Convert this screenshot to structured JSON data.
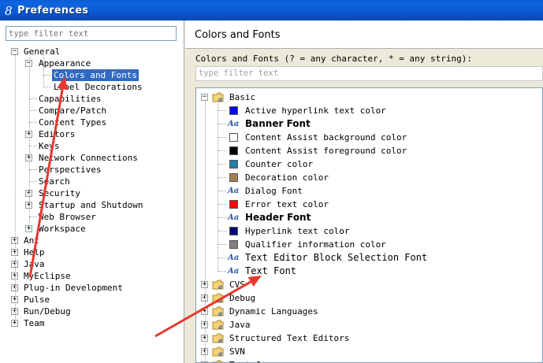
{
  "window": {
    "title": "Preferences"
  },
  "left": {
    "filter_placeholder": "type filter text",
    "tree": [
      {
        "label": "General",
        "depth": 0,
        "toggle": "-"
      },
      {
        "label": "Appearance",
        "depth": 1,
        "toggle": "-"
      },
      {
        "label": "Colors and Fonts",
        "depth": 2,
        "toggle": "",
        "selected": true
      },
      {
        "label": "Label Decorations",
        "depth": 2,
        "toggle": ""
      },
      {
        "label": "Capabilities",
        "depth": 1,
        "toggle": ""
      },
      {
        "label": "Compare/Patch",
        "depth": 1,
        "toggle": ""
      },
      {
        "label": "Content Types",
        "depth": 1,
        "toggle": ""
      },
      {
        "label": "Editors",
        "depth": 1,
        "toggle": "+"
      },
      {
        "label": "Keys",
        "depth": 1,
        "toggle": ""
      },
      {
        "label": "Network Connections",
        "depth": 1,
        "toggle": "+"
      },
      {
        "label": "Perspectives",
        "depth": 1,
        "toggle": ""
      },
      {
        "label": "Search",
        "depth": 1,
        "toggle": ""
      },
      {
        "label": "Security",
        "depth": 1,
        "toggle": "+"
      },
      {
        "label": "Startup and Shutdown",
        "depth": 1,
        "toggle": "+"
      },
      {
        "label": "Web Browser",
        "depth": 1,
        "toggle": ""
      },
      {
        "label": "Workspace",
        "depth": 1,
        "toggle": "+"
      },
      {
        "label": "Ant",
        "depth": 0,
        "toggle": "+"
      },
      {
        "label": "Help",
        "depth": 0,
        "toggle": "+"
      },
      {
        "label": "Java",
        "depth": 0,
        "toggle": "+"
      },
      {
        "label": "MyEclipse",
        "depth": 0,
        "toggle": "+"
      },
      {
        "label": "Plug-in Development",
        "depth": 0,
        "toggle": "+"
      },
      {
        "label": "Pulse",
        "depth": 0,
        "toggle": "+"
      },
      {
        "label": "Run/Debug",
        "depth": 0,
        "toggle": "+"
      },
      {
        "label": "Team",
        "depth": 0,
        "toggle": "+"
      }
    ]
  },
  "right": {
    "title": "Colors and Fonts",
    "description": "Colors and Fonts (? = any character, * = any string):",
    "filter_placeholder": "type filter text",
    "basic_label": "Basic",
    "basic_items": [
      {
        "label": "Active hyperlink text color",
        "kind": "color",
        "color": "#0000ff"
      },
      {
        "label": "Banner Font",
        "kind": "font",
        "style": "bold"
      },
      {
        "label": "Content Assist background color",
        "kind": "color",
        "color": "#ffffff"
      },
      {
        "label": "Content Assist foreground color",
        "kind": "color",
        "color": "#000000"
      },
      {
        "label": "Counter color",
        "kind": "color",
        "color": "#1f7fa8"
      },
      {
        "label": "Decoration color",
        "kind": "color",
        "color": "#a57f4e"
      },
      {
        "label": "Dialog Font",
        "kind": "font",
        "style": "normal"
      },
      {
        "label": "Error text color",
        "kind": "color",
        "color": "#ff0000"
      },
      {
        "label": "Header Font",
        "kind": "font",
        "style": "bold"
      },
      {
        "label": "Hyperlink text color",
        "kind": "color",
        "color": "#00007f"
      },
      {
        "label": "Qualifier information color",
        "kind": "color",
        "color": "#7f7f7f"
      },
      {
        "label": "Text Editor Block Selection Font",
        "kind": "font",
        "style": "big"
      },
      {
        "label": "Text Font",
        "kind": "font",
        "style": "big"
      }
    ],
    "categories": [
      "CVS",
      "Debug",
      "Dynamic Languages",
      "Java",
      "Structured Text Editors",
      "SVN",
      "Text Compare"
    ]
  },
  "colors": {
    "selection": "#316ac5",
    "annotation_arrow": "#e8382d"
  }
}
